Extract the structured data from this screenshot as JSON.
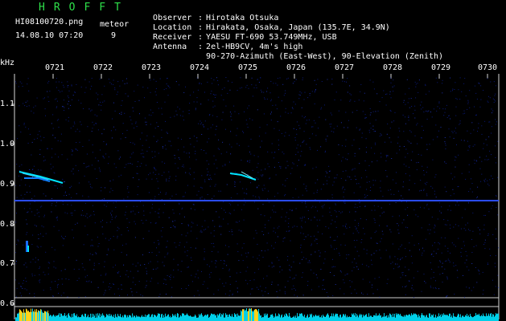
{
  "header": {
    "logo": "HROFFT",
    "filename": "HI08100720.png",
    "datetime": "14.08.10 07:20",
    "meteor_label": "meteor",
    "meteor_count": "9"
  },
  "info": [
    {
      "key": "Observer",
      "sep": ":",
      "value": "Hirotaka Otsuka"
    },
    {
      "key": "Location",
      "sep": ":",
      "value": "Hirakata, Osaka, Japan (135.7E, 34.9N)"
    },
    {
      "key": "Receiver",
      "sep": ":",
      "value": "YAESU FT-690 53.749MHz, USB"
    },
    {
      "key": "Antenna",
      "sep": ":",
      "value": "2el-HB9CV, 4m's high"
    },
    {
      "key": "",
      "sep": "",
      "value": "90-270-Azimuth (East-West), 90-Elevation (Zenith)"
    }
  ],
  "axis": {
    "y_unit": "kHz",
    "y_ticks": [
      "1.1",
      "1.0",
      "0.9",
      "0.8",
      "0.7",
      "0.6"
    ],
    "x_ticks": [
      "0721",
      "0722",
      "0723",
      "0724",
      "0725",
      "0726",
      "0727",
      "0728",
      "0729",
      "0730"
    ]
  },
  "colors": {
    "background": "#000000",
    "logo": "#2ee04a",
    "carrier": "#2a4cff",
    "signal": "#00e5ff",
    "noise": "#0a1a7a",
    "spectrum_base": "#00cfe8",
    "spectrum_peak": "#ffd21a"
  }
}
